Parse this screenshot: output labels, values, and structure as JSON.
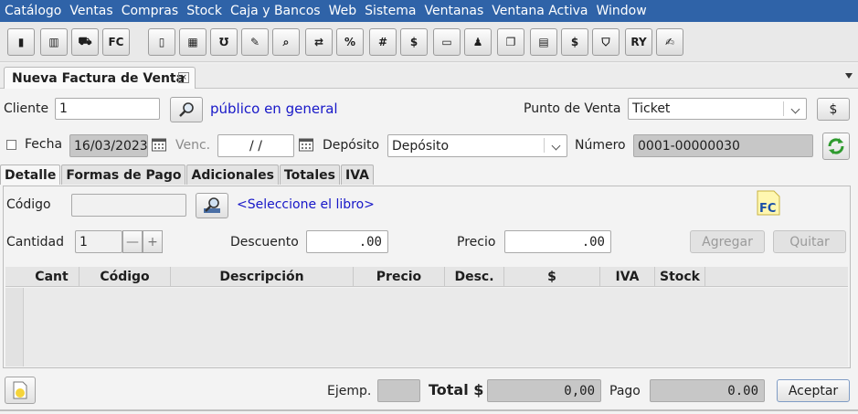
{
  "menu": [
    "Catálogo",
    "Ventas",
    "Compras",
    "Stock",
    "Caja y Bancos",
    "Web",
    "Sistema",
    "Ventanas",
    "Ventana Activa",
    "Window"
  ],
  "toolbar": {
    "buttons": [
      {
        "name": "book-icon",
        "glyph": "▮"
      },
      {
        "name": "barcode-icon",
        "glyph": "▥"
      },
      {
        "name": "truck-icon",
        "glyph": "⛟"
      },
      {
        "name": "invoice-fc-icon",
        "glyph": "FC"
      },
      {
        "name": "document-icon",
        "glyph": "▯"
      },
      {
        "name": "calculator-icon",
        "glyph": "▦"
      },
      {
        "name": "receipt-icon",
        "glyph": "℧"
      },
      {
        "name": "pencil-paper-icon",
        "glyph": "✎"
      },
      {
        "name": "search-product-icon",
        "glyph": "⌕"
      },
      {
        "name": "transfer-icon",
        "glyph": "⇄"
      },
      {
        "name": "percent-edit-icon",
        "glyph": "%"
      },
      {
        "name": "number-edit-icon",
        "glyph": "#"
      },
      {
        "name": "dollar-icon",
        "glyph": "$"
      },
      {
        "name": "card-icon",
        "glyph": "▭"
      },
      {
        "name": "user-icon",
        "glyph": "♟"
      },
      {
        "name": "copy-document-icon",
        "glyph": "❐"
      },
      {
        "name": "check-icon",
        "glyph": "▤"
      },
      {
        "name": "ticket-icon",
        "glyph": "$"
      },
      {
        "name": "bucket-icon",
        "glyph": "⛉"
      },
      {
        "name": "ry-icon",
        "glyph": "RY"
      },
      {
        "name": "edit-list-icon",
        "glyph": "✍"
      }
    ]
  },
  "tab": {
    "title": "Nueva Factura de Venta"
  },
  "cliente": {
    "label": "Cliente",
    "value": "1",
    "name": "público en general"
  },
  "punto_venta": {
    "label": "Punto de Venta",
    "value": "Ticket",
    "dollar": "$"
  },
  "fecha": {
    "label": "Fecha",
    "value": "16/03/2023"
  },
  "venc": {
    "label": "Venc.",
    "value": "/ /"
  },
  "deposito": {
    "label": "Depósito",
    "value": "Depósito"
  },
  "numero": {
    "label": "Número",
    "value": "0001-00000030"
  },
  "inner_tabs": [
    "Detalle",
    "Formas de Pago",
    "Adicionales",
    "Totales",
    "IVA"
  ],
  "detalle": {
    "codigo_label": "Código",
    "codigo_value": "",
    "libro_link": "<Seleccione el libro>",
    "cantidad_label": "Cantidad",
    "cantidad_value": "1",
    "descuento_label": "Descuento",
    "descuento_value": ".00",
    "precio_label": "Precio",
    "precio_value": ".00",
    "agregar": "Agregar",
    "quitar": "Quitar",
    "fc_badge": "FC"
  },
  "columns": [
    "Cant",
    "Código",
    "Descripción",
    "Precio",
    "Desc.",
    "$",
    "IVA",
    "Stock"
  ],
  "footer": {
    "ejemp_label": "Ejemp.",
    "ejemp_value": "",
    "total_label": "Total $",
    "total_value": "0,00",
    "pago_label": "Pago",
    "pago_value": "0.00",
    "aceptar": "Aceptar"
  }
}
